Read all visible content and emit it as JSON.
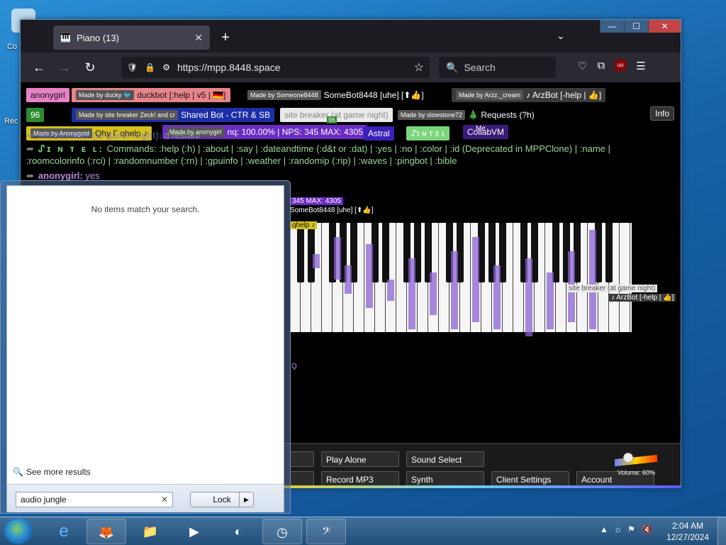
{
  "desktop": {
    "icon1_label": "Co",
    "icon2_label": "Rec"
  },
  "browser": {
    "tab_title": "Piano (13)",
    "url": "https://mpp.8448.space",
    "search_placeholder": "Search",
    "window_controls": {
      "minimize": "—",
      "maximize": "☐",
      "close": "✕"
    }
  },
  "page": {
    "chips": [
      {
        "tag": "",
        "label": "anonygirl",
        "bg": "#e882c8",
        "fg": "#111"
      },
      {
        "tag": "Made by ducky 🐦",
        "label": "duckbot [:help | v5 | 🇩🇪]",
        "bg": "#e8848b",
        "fg": "#111"
      },
      {
        "tag": "Made by Someone8448",
        "label": "SomeBot8448 [uhe] [⬆👍]",
        "bg": "#000",
        "fg": "#fff"
      },
      {
        "tag": "Made by Arzz._cream",
        "label": "♪ ArzBot [-help | 👍]",
        "bg": "#3a3a3a",
        "fg": "#fff"
      },
      {
        "tag": "",
        "label": "96",
        "bg": "#2d8a2d",
        "fg": "#fff"
      },
      {
        "tag": "Made by site breaker Zeck! and cr",
        "label": "Shared Bot - CTR & SB",
        "bg": "#1c2fa8",
        "fg": "#fff"
      },
      {
        "tag": "",
        "label": "site breaker (at game night)",
        "bg": "#eaeaea",
        "fg": "#888"
      },
      {
        "tag": "Made by slowstone72",
        "label": "🎄 Requests (?h)",
        "bg": "#000",
        "fg": "#fff"
      },
      {
        "tag": "Made by Anonygold",
        "label": "Qhy Γ qhelp ♪",
        "bg": "#d6c11e",
        "fg": "#111"
      },
      {
        "tag": "Made by anonygirl",
        "label": "nq: 100.00% | NPS: 345 MAX: 4305",
        "bg": "#6a2cc4",
        "fg": "#fff"
      },
      {
        "tag": "",
        "label": "Astral",
        "bg": "#3a1fb8",
        "fg": "#fff"
      },
      {
        "tag": "",
        "label": "ᔑɪ ɴ ᴛ ᴇ ʟ",
        "bg": "#7ad67a",
        "fg": "#fff"
      },
      {
        "tag": "",
        "label": "CollabVM",
        "bg": "#3b1a7a",
        "fg": "#fff"
      }
    ],
    "info_button": "Info",
    "chat": [
      {
        "name": "site breaker (at game night):",
        "text": "d restart/",
        "color": "#7a7cbf"
      },
      {
        "name": "ᔑɪ ɴ ᴛ ᴇ ʟ:",
        "text": "Commands: :help (:h) | :about | :say | :dateandtime (:d&t or :dat) | :yes | :no | :color | :id (Deprecated in MPPClone) | :name | :roomcolorinfo (:rci) | :randomnumber (:rn) | :gpuinfo | :weather | :randomip (:rip) | :waves | :pingbot | :bible",
        "color": "#9ad69a"
      },
      {
        "name": "anonygirl:",
        "text": "yes",
        "color": "#b98adf"
      }
    ],
    "cursor_labels": {
      "somebot": "SomeBot8448 [uhe] [⬆👍]",
      "help": "qhelp ♪",
      "nps": "345 MAX: 4305",
      "sitebreaker": "site breaker (at game night)",
      "arzbot": "♪ ArzBot [-help | 👍]",
      "ninetysix": "96",
      "me": "Me",
      "q": "Q"
    },
    "controls": {
      "play_alone": "Play Alone",
      "sound_select": "Sound Select",
      "record_mp3": "Record MP3",
      "synth": "Synth",
      "client_settings": "Client Settings",
      "account": "Account",
      "volume_label": "Volume: 60%"
    }
  },
  "startmenu": {
    "no_items": "No items match your search.",
    "see_more": "See more results",
    "search_value": "audio jungle",
    "lock_label": "Lock"
  },
  "taskbar": {
    "time": "2:04 AM",
    "date": "12/27/2024"
  }
}
